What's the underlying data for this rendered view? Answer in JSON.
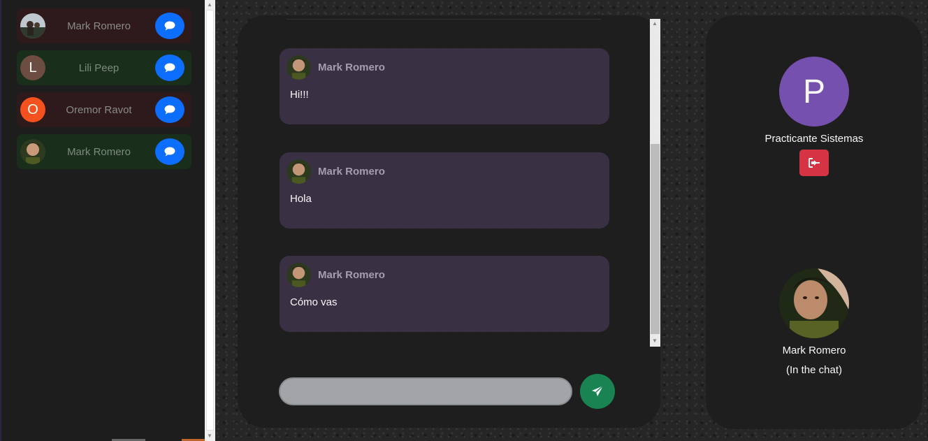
{
  "contacts": [
    {
      "name": "Mark Romero",
      "initial": "",
      "avatar": "photo",
      "theme": "red"
    },
    {
      "name": "Lili Peep",
      "initial": "L",
      "avatar": "letter",
      "avatar_color": "#6d4c41",
      "theme": "green"
    },
    {
      "name": "Oremor Ravot",
      "initial": "O",
      "avatar": "letter",
      "avatar_color": "#f4511e",
      "theme": "red"
    },
    {
      "name": "Mark Romero",
      "initial": "",
      "avatar": "photo",
      "theme": "green"
    }
  ],
  "chat": {
    "messages": [
      {
        "author": "Mark Romero",
        "text": "Hi!!!"
      },
      {
        "author": "Mark Romero",
        "text": "Hola"
      },
      {
        "author": "Mark Romero",
        "text": "Cómo vas"
      }
    ],
    "input_value": "",
    "input_placeholder": ""
  },
  "profile": {
    "initial": "P",
    "name": "Practicante Sistemas",
    "avatar_color": "#7952b3"
  },
  "peer": {
    "name": "Mark Romero",
    "status": "(In the chat)"
  },
  "icons": {
    "message": "chat-bubble-icon",
    "send": "paper-plane-icon",
    "logout": "sign-out-icon"
  },
  "colors": {
    "primary": "#0d6efd",
    "success": "#198754",
    "danger": "#dc3545",
    "bubble": "#3a3145"
  }
}
